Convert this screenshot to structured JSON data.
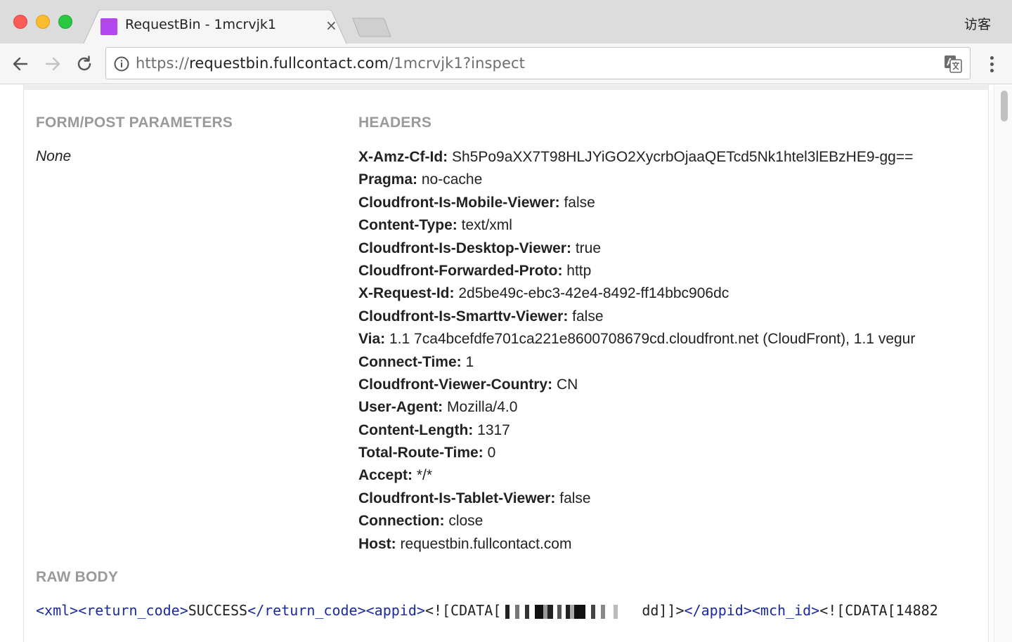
{
  "tab": {
    "title": "RequestBin - 1mcrvjk1",
    "close_glyph": "×"
  },
  "profile": {
    "label": "访客"
  },
  "omnibox": {
    "scheme": "https://",
    "host": "requestbin.fullcontact.com",
    "path": "/1mcrvjk1?inspect"
  },
  "icons": {
    "back": "back-arrow-icon",
    "forward": "forward-arrow-icon",
    "reload": "reload-icon",
    "info": "info-icon",
    "translate": "translate-icon",
    "menu": "kebab-menu-icon"
  },
  "colors": {
    "favicon": "#b446f0",
    "section_heading": "#9a9a9a",
    "xml_tag": "#1a2aa0"
  },
  "form_params": {
    "heading": "FORM/POST PARAMETERS",
    "value": "None"
  },
  "headers": {
    "heading": "HEADERS",
    "items": [
      {
        "key": "X-Amz-Cf-Id:",
        "value": "Sh5Po9aXX7T98HLJYiGO2XycrbOjaaQETcd5Nk1htel3lEBzHE9-gg=="
      },
      {
        "key": "Pragma:",
        "value": "no-cache"
      },
      {
        "key": "Cloudfront-Is-Mobile-Viewer:",
        "value": "false"
      },
      {
        "key": "Content-Type:",
        "value": "text/xml"
      },
      {
        "key": "Cloudfront-Is-Desktop-Viewer:",
        "value": "true"
      },
      {
        "key": "Cloudfront-Forwarded-Proto:",
        "value": "http"
      },
      {
        "key": "X-Request-Id:",
        "value": "2d5be49c-ebc3-42e4-8492-ff14bbc906dc"
      },
      {
        "key": "Cloudfront-Is-Smarttv-Viewer:",
        "value": "false"
      },
      {
        "key": "Via:",
        "value": "1.1 7ca4bcefdfe701ca221e8600708679cd.cloudfront.net (CloudFront), 1.1 vegur"
      },
      {
        "key": "Connect-Time:",
        "value": "1"
      },
      {
        "key": "Cloudfront-Viewer-Country:",
        "value": "CN"
      },
      {
        "key": "User-Agent:",
        "value": "Mozilla/4.0"
      },
      {
        "key": "Content-Length:",
        "value": "1317"
      },
      {
        "key": "Total-Route-Time:",
        "value": "0"
      },
      {
        "key": "Accept:",
        "value": "*/*"
      },
      {
        "key": "Cloudfront-Is-Tablet-Viewer:",
        "value": "false"
      },
      {
        "key": "Connection:",
        "value": "close"
      },
      {
        "key": "Host:",
        "value": "requestbin.fullcontact.com"
      }
    ]
  },
  "raw_body": {
    "heading": "RAW BODY",
    "parts": {
      "t1": "<xml>",
      "t2": "<return_code>",
      "v1": "SUCCESS",
      "t3": "</return_code>",
      "t4": "<appid>",
      "v2a": "<![CDATA[",
      "v2b": "dd]]>",
      "t5": "</appid>",
      "t6": "<mch_id>",
      "v3": "<![CDATA[14882"
    }
  }
}
